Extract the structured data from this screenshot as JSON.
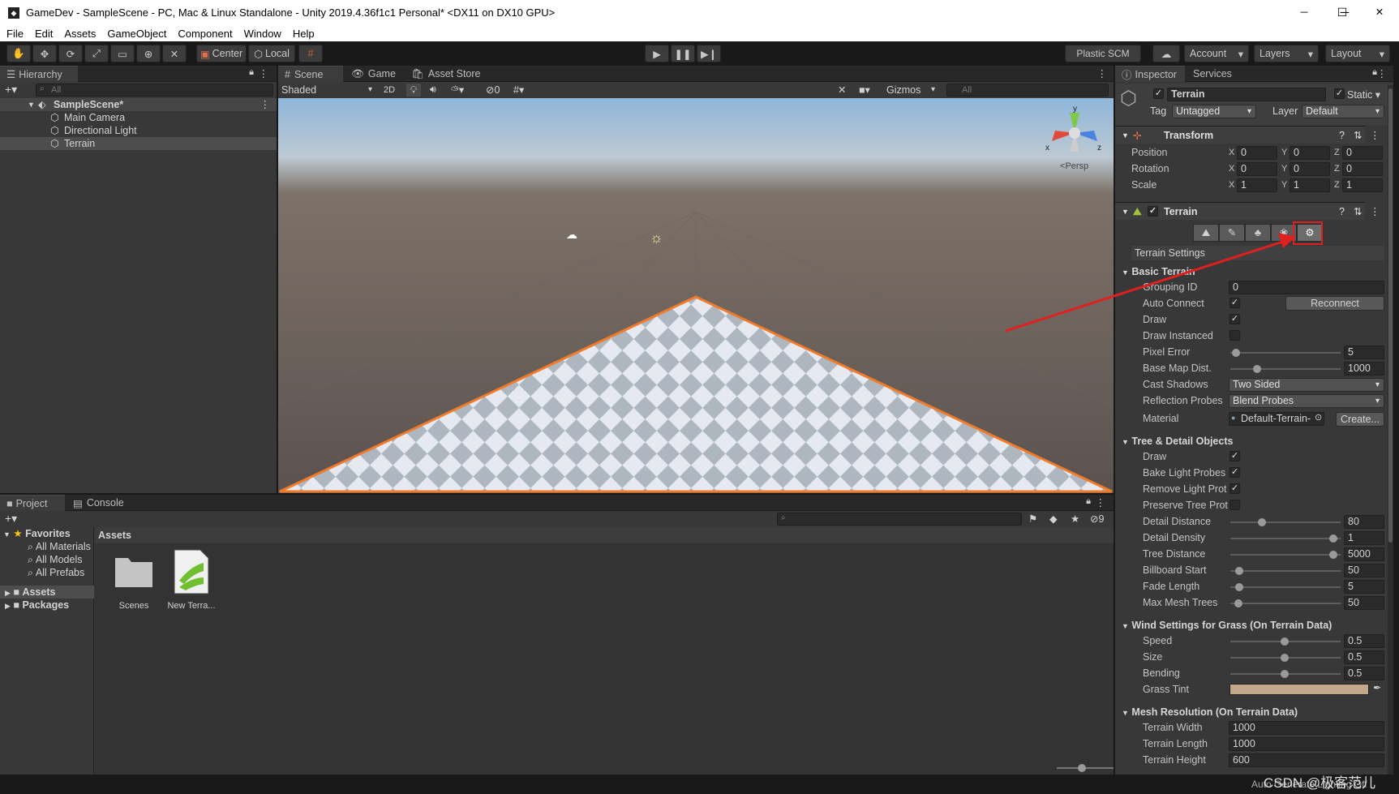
{
  "window": {
    "title": "GameDev - SampleScene - PC, Mac & Linux Standalone - Unity 2019.4.36f1c1 Personal* <DX11 on DX10 GPU>",
    "min": "─",
    "max": "☐",
    "close": "✕"
  },
  "menu": [
    "File",
    "Edit",
    "Assets",
    "GameObject",
    "Component",
    "Window",
    "Help"
  ],
  "toolbar": {
    "center": "Center",
    "local": "Local",
    "plastic": "Plastic SCM",
    "account": "Account",
    "layers": "Layers",
    "layout": "Layout"
  },
  "hierarchy": {
    "tab": "Hierarchy",
    "search": "All",
    "scene": "SampleScene*",
    "items": [
      "Main Camera",
      "Directional Light",
      "Terrain"
    ]
  },
  "scene": {
    "tabs": [
      "Scene",
      "Game",
      "Asset Store"
    ],
    "shading": "Shaded",
    "mode2d": "2D",
    "hidden_count": "0",
    "gizmos": "Gizmos",
    "search": "All",
    "persp": "Persp",
    "axis_x": "x",
    "axis_z": "z",
    "axis_y": "y"
  },
  "project": {
    "tabs": [
      "Project",
      "Console"
    ],
    "favorites": "Favorites",
    "fav_items": [
      "All Materials",
      "All Models",
      "All Prefabs"
    ],
    "roots": [
      "Assets",
      "Packages"
    ],
    "breadcrumb": "Assets",
    "assets": [
      "Scenes",
      "New Terra..."
    ],
    "hidden_count": "9"
  },
  "inspector": {
    "tabs": [
      "Inspector",
      "Services"
    ],
    "object_name": "Terrain",
    "static": "Static",
    "tag_label": "Tag",
    "tag": "Untagged",
    "layer_label": "Layer",
    "layer": "Default",
    "transform": {
      "title": "Transform",
      "rows": [
        {
          "label": "Position",
          "x": "0",
          "y": "0",
          "z": "0"
        },
        {
          "label": "Rotation",
          "x": "0",
          "y": "0",
          "z": "0"
        },
        {
          "label": "Scale",
          "x": "1",
          "y": "1",
          "z": "1"
        }
      ]
    },
    "terrain": {
      "title": "Terrain",
      "settings_title": "Terrain Settings"
    },
    "basic": {
      "title": "Basic Terrain",
      "grouping_id": {
        "label": "Grouping ID",
        "value": "0"
      },
      "auto_connect": {
        "label": "Auto Connect",
        "button": "Reconnect"
      },
      "draw": {
        "label": "Draw"
      },
      "draw_instanced": {
        "label": "Draw Instanced"
      },
      "pixel_error": {
        "label": "Pixel Error",
        "value": "5"
      },
      "base_map": {
        "label": "Base Map Dist.",
        "value": "1000"
      },
      "cast_shadows": {
        "label": "Cast Shadows",
        "value": "Two Sided"
      },
      "reflection": {
        "label": "Reflection Probes",
        "value": "Blend Probes"
      },
      "material": {
        "label": "Material",
        "value": "Default-Terrain-",
        "button": "Create..."
      }
    },
    "tree": {
      "title": "Tree & Detail Objects",
      "checks": [
        {
          "label": "Draw"
        },
        {
          "label": "Bake Light Probes"
        },
        {
          "label": "Remove Light Prot"
        },
        {
          "label": "Preserve Tree Prot"
        }
      ],
      "sliders": [
        {
          "label": "Detail Distance",
          "value": "80",
          "pos": 0.27
        },
        {
          "label": "Detail Density",
          "value": "1",
          "pos": 0.97
        },
        {
          "label": "Tree Distance",
          "value": "5000",
          "pos": 0.97
        },
        {
          "label": "Billboard Start",
          "value": "50",
          "pos": 0.05
        },
        {
          "label": "Fade Length",
          "value": "5",
          "pos": 0.05
        },
        {
          "label": "Max Mesh Trees",
          "value": "50",
          "pos": 0.04
        }
      ]
    },
    "wind": {
      "title": "Wind Settings for Grass (On Terrain Data)",
      "sliders": [
        {
          "label": "Speed",
          "value": "0.5",
          "pos": 0.49
        },
        {
          "label": "Size",
          "value": "0.5",
          "pos": 0.49
        },
        {
          "label": "Bending",
          "value": "0.5",
          "pos": 0.49
        }
      ],
      "tint_label": "Grass Tint",
      "tint_color": "#c3a88a"
    },
    "mesh": {
      "title": "Mesh Resolution (On Terrain Data)",
      "rows": [
        {
          "label": "Terrain Width",
          "value": "1000"
        },
        {
          "label": "Terrain Length",
          "value": "1000"
        },
        {
          "label": "Terrain Height",
          "value": "600"
        }
      ]
    }
  },
  "status": {
    "right": "Auto Generate Lighting Off",
    "watermark": "CSDN @极客范儿"
  },
  "colors": {
    "accent": "#f07b2a",
    "highlight": "#e01f1f"
  }
}
